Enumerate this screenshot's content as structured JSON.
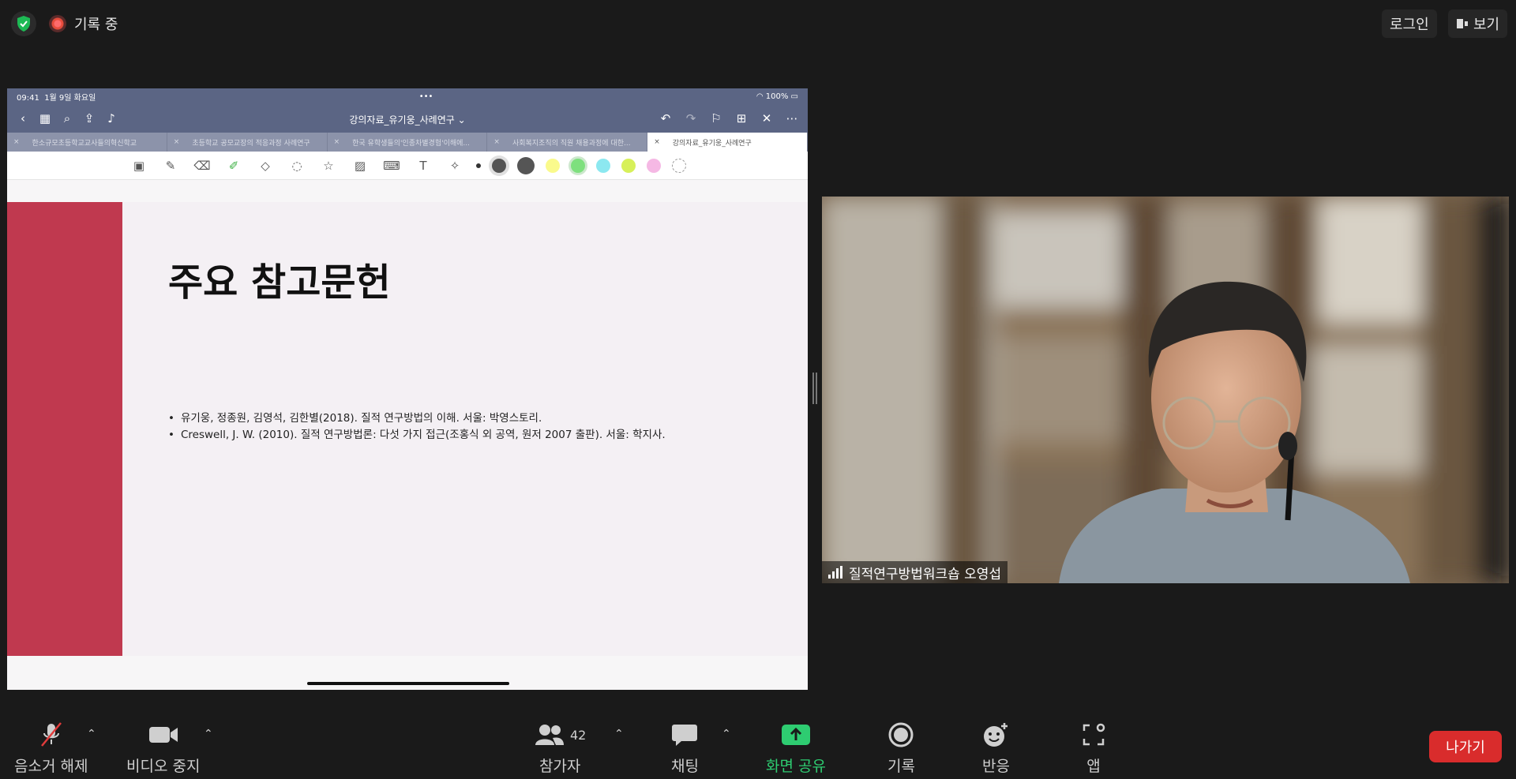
{
  "top": {
    "recording_label": "기록 중",
    "login_label": "로그인",
    "view_label": "보기"
  },
  "shared": {
    "status_time": "09:41",
    "status_date": "1월 9일 화요일",
    "status_battery": "100%",
    "doc_title": "강의자료_유기웅_사례연구 ⌄",
    "tabs": [
      "한소규모초등학교교사들의혁신학교",
      "초등학교 공모교장의 적응과정 사례연구",
      "한국 유학생들의'인종차별경험'이해에...",
      "사회복지조직의 직원 채용과정에 대한...",
      "강의자료_유기웅_사례연구"
    ],
    "slide_title": "주요 참고문헌",
    "references": [
      "유기웅, 정종원, 김영석, 김한별(2018). 질적 연구방법의 이해. 서울: 박영스토리.",
      "Creswell, J. W. (2010). 질적 연구방법론: 다섯 가지 접근(조홍식 외 공역, 원저 2007 출판). 서울: 학지사."
    ],
    "colors": {
      "accent_bar": "#c0394f",
      "header": "#5b6584"
    }
  },
  "video": {
    "participant_name": "질적연구방법워크숍 오영섭"
  },
  "controls": {
    "mute_label": "음소거 해제",
    "video_label": "비디오 중지",
    "participants_label": "참가자",
    "participants_count": "42",
    "chat_label": "채팅",
    "share_label": "화면 공유",
    "record_label": "기록",
    "reactions_label": "반응",
    "apps_label": "앱",
    "leave_label": "나가기"
  }
}
